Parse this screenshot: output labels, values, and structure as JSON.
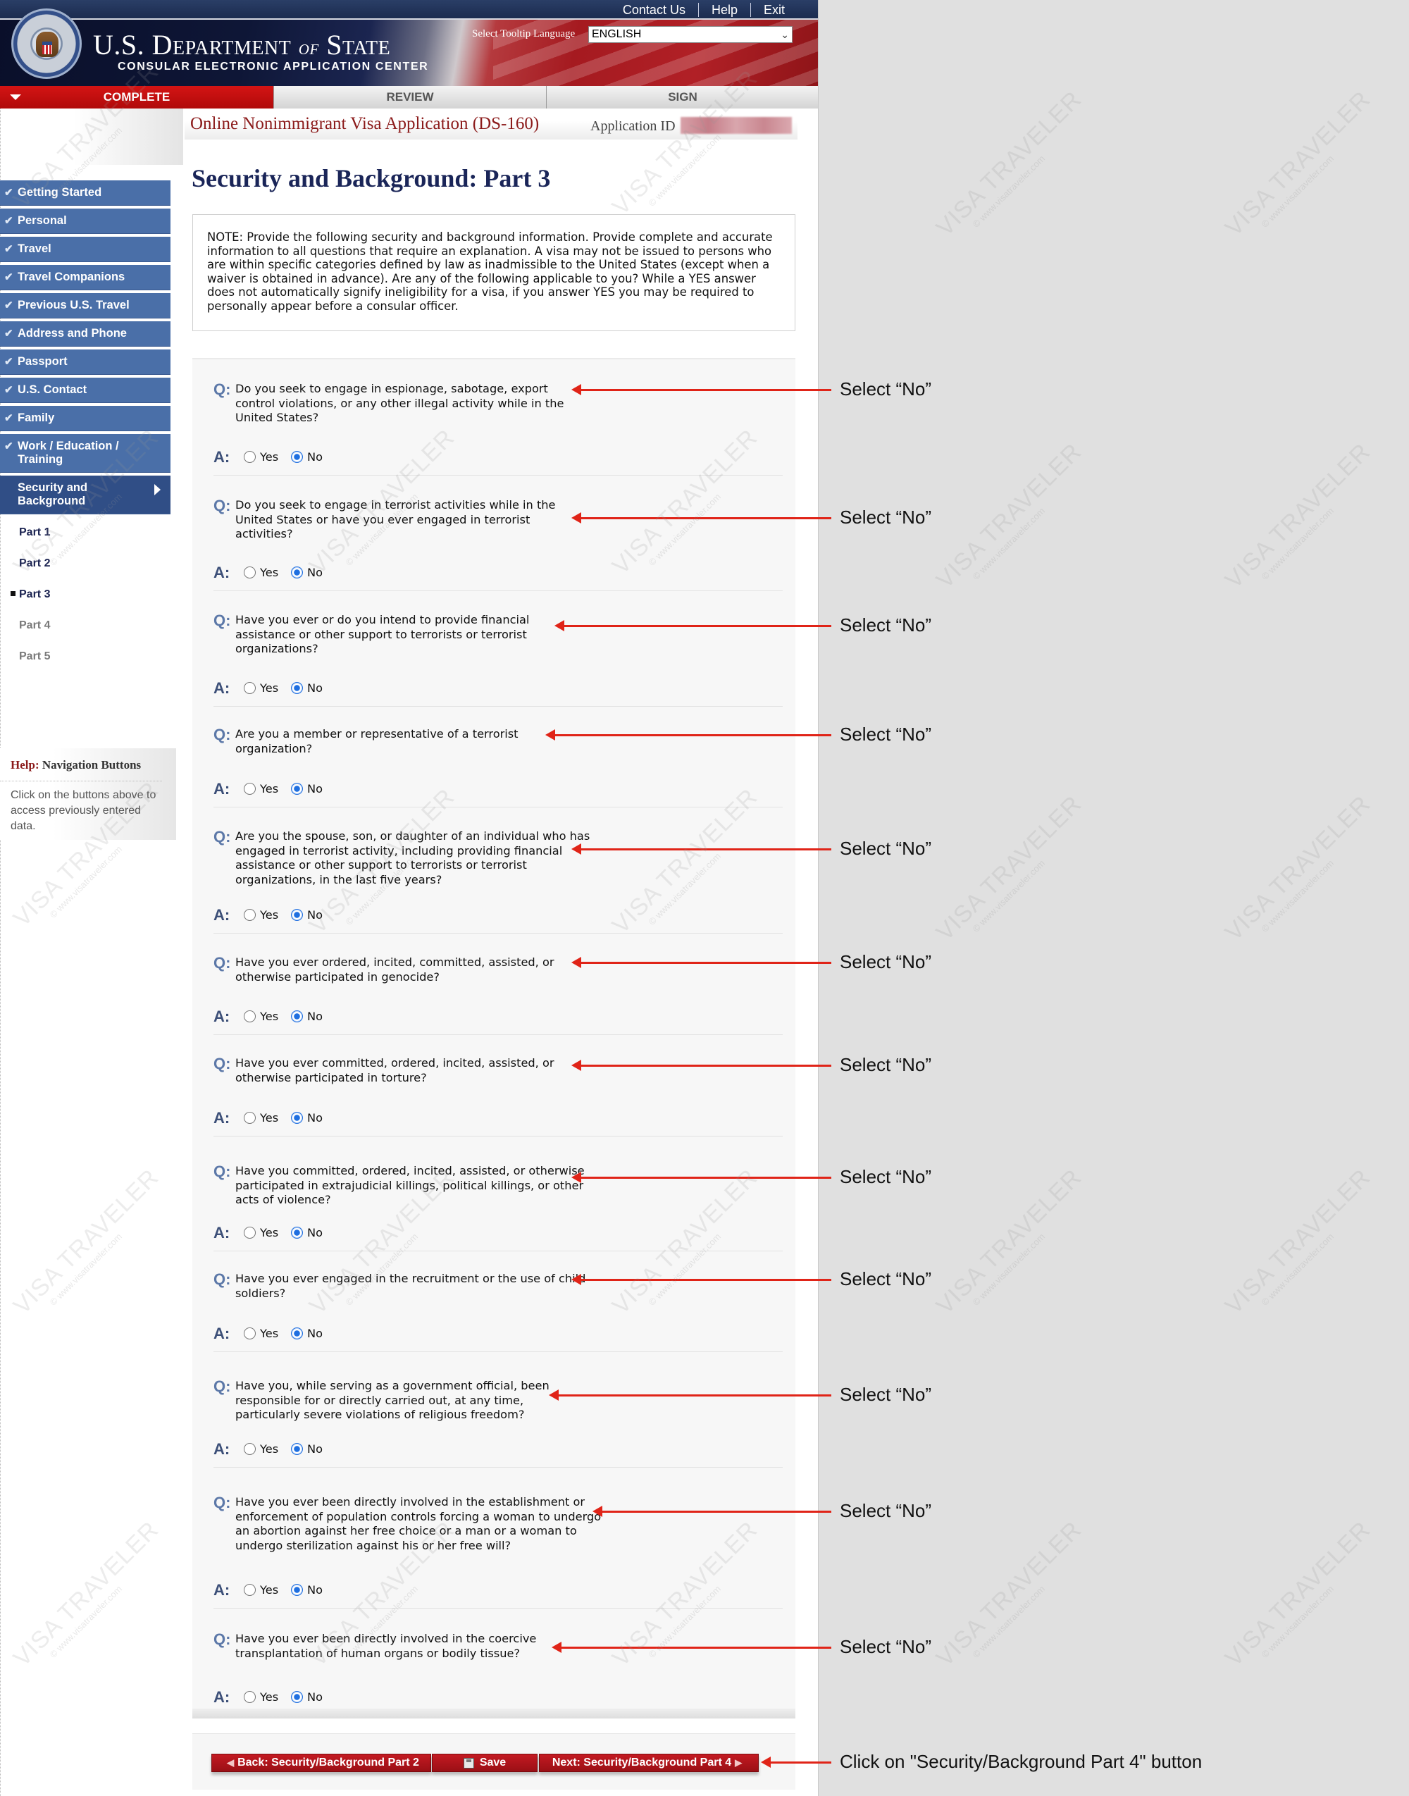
{
  "header": {
    "top_links": [
      "Contact Us",
      "Help",
      "Exit"
    ],
    "dept_title_part1": "U.S. Department ",
    "dept_title_of": "of",
    "dept_title_part2": " State",
    "dept_subtitle": "CONSULAR ELECTRONIC APPLICATION CENTER",
    "tooltip_language_label": "Select Tooltip Language",
    "tooltip_language_value": "ENGLISH"
  },
  "tabs": [
    {
      "label": "COMPLETE",
      "active": true
    },
    {
      "label": "REVIEW",
      "active": false
    },
    {
      "label": "SIGN",
      "active": false
    }
  ],
  "form_title": "Online Nonimmigrant Visa Application (DS-160)",
  "application_id_label": "Application ID",
  "application_id_value": "[redacted]",
  "page_heading": "Security and Background: Part 3",
  "note": "NOTE: Provide the following security and background information. Provide complete and accurate information to all questions that require an explanation. A visa may not be issued to persons who are within specific categories defined by law as inadmissible to the United States (except when a waiver is obtained in advance). Are any of the following applicable to you? While a YES answer does not automatically signify ineligibility for a visa, if you answer YES you may be required to personally appear before a consular officer.",
  "sidebar": {
    "items": [
      {
        "label": "Getting Started",
        "completed": true
      },
      {
        "label": "Personal",
        "completed": true
      },
      {
        "label": "Travel",
        "completed": true
      },
      {
        "label": "Travel Companions",
        "completed": true
      },
      {
        "label": "Previous U.S. Travel",
        "completed": true
      },
      {
        "label": "Address and Phone",
        "completed": true
      },
      {
        "label": "Passport",
        "completed": true
      },
      {
        "label": "U.S. Contact",
        "completed": true
      },
      {
        "label": "Family",
        "completed": true
      },
      {
        "label": "Work / Education / Training",
        "completed": true
      },
      {
        "label": "Security and Background",
        "completed": false,
        "current": true
      }
    ],
    "sub_items": [
      {
        "label": "Part 1",
        "enabled": true
      },
      {
        "label": "Part 2",
        "enabled": true
      },
      {
        "label": "Part 3",
        "enabled": true,
        "current": true
      },
      {
        "label": "Part 4",
        "enabled": false
      },
      {
        "label": "Part 5",
        "enabled": false
      }
    ],
    "check_icon": "✔"
  },
  "help": {
    "prefix": "Help:",
    "title": " Navigation Buttons",
    "text": "Click on the buttons above to access previously entered data."
  },
  "labels": {
    "q": "Q:",
    "a": "A:",
    "yes": "Yes",
    "no": "No"
  },
  "questions": [
    {
      "text": "Do you seek to engage in espionage, sabotage, export control violations, or any other illegal activity while in the United States?",
      "answer": "No"
    },
    {
      "text": "Do you seek to engage in terrorist activities while in the United States or have you ever engaged in terrorist activities?",
      "answer": "No"
    },
    {
      "text": "Have you ever or do you intend to provide financial assistance or other support to terrorists or terrorist organizations?",
      "answer": "No"
    },
    {
      "text": "Are you a member or representative of a terrorist organization?",
      "answer": "No"
    },
    {
      "text": "Are you the spouse, son, or daughter of an individual who has engaged in terrorist activity, including providing financial assistance or other support to terrorists or terrorist organizations, in the last five years?",
      "answer": "No"
    },
    {
      "text": "Have you ever ordered, incited, committed, assisted, or otherwise participated in genocide?",
      "answer": "No"
    },
    {
      "text": "Have you ever committed, ordered, incited, assisted, or otherwise participated in torture?",
      "answer": "No"
    },
    {
      "text": "Have you committed, ordered, incited, assisted, or otherwise participated in extrajudicial killings, political killings, or other acts of violence?",
      "answer": "No"
    },
    {
      "text": "Have you ever engaged in the recruitment or the use of child soldiers?",
      "answer": "No"
    },
    {
      "text": "Have you, while serving as a government official, been responsible for or directly carried out, at any time, particularly severe violations of religious freedom?",
      "answer": "No"
    },
    {
      "text": "Have you ever been directly involved in the establishment or enforcement of population controls forcing a woman to undergo an abortion against her free choice or a man or a woman to undergo sterilization against his or her free will?",
      "answer": "No"
    },
    {
      "text": "Have you ever been directly involved in the coercive transplantation of human organs or bodily tissue?",
      "answer": "No"
    }
  ],
  "buttons": {
    "back": "Back: Security/Background Part 2",
    "save": "Save",
    "next": "Next: Security/Background Part 4"
  },
  "annotations": {
    "select_no": "Select “No”",
    "click_next": "Click on \"Security/Background Part 4\" button"
  },
  "watermark": {
    "title": "VISA TRAVELER",
    "url": "© www.visatraveler.com"
  },
  "colors": {
    "brand_red": "#b00a0a",
    "nav_blue": "#4a6fa8",
    "annotation_red": "#e02418",
    "radio_blue": "#1f6fe0"
  }
}
